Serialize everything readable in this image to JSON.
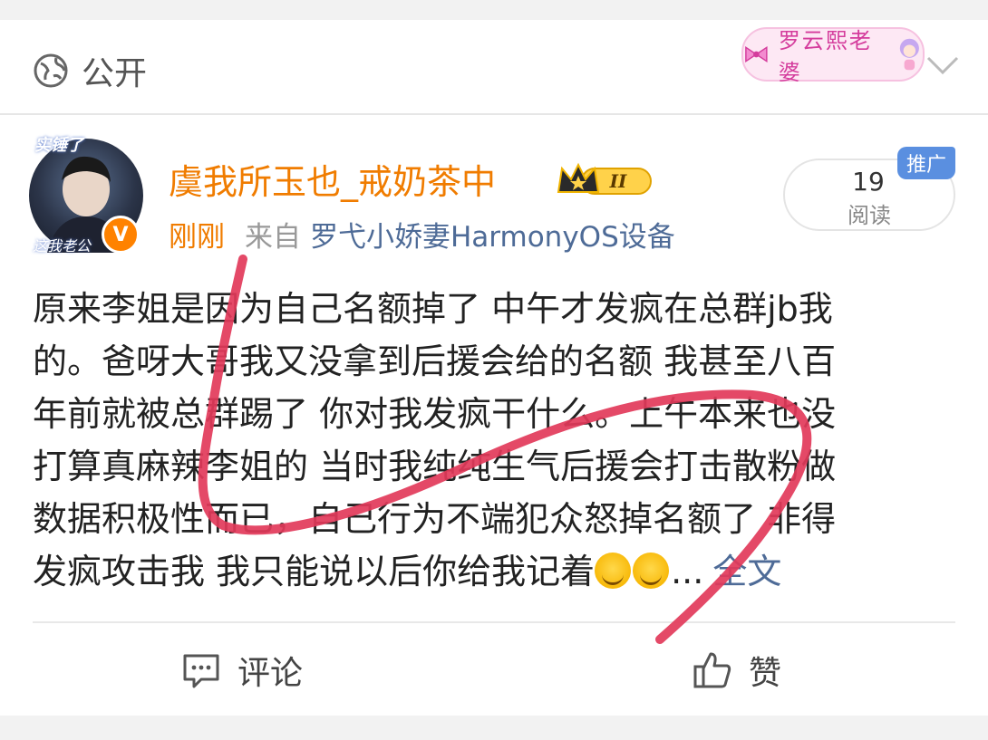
{
  "header": {
    "visibility_label": "公开",
    "sticker_text": "罗云熙老婆"
  },
  "post": {
    "author": {
      "username": "虞我所玉也_戒奶茶中",
      "avatar_tag_top": "实锤了",
      "avatar_tag_bottom": "这我老公",
      "verified_mark": "V",
      "membership_level": "II"
    },
    "time": "刚刚",
    "source_prefix": "来自",
    "source_device": "罗弋小娇妻HarmonyOS设备",
    "read_count": "19",
    "read_label": "阅读",
    "ad_badge": "推广",
    "body_lines": [
      "原来李姐是因为自己名额掉了 中午才发疯在总群jb我",
      "的。爸呀大哥我又没拿到后援会给的名额 我甚至八百",
      "年前就被总群踢了 你对我发疯干什么。上午本来也没",
      "打算真麻辣李姐的 当时我纯纯生气后援会打击散粉做",
      "数据积极性而已，自己行为不端犯众怒掉名额了 非得",
      "发疯攻击我 我只能说以后你给我记着"
    ],
    "ellipsis": "...",
    "full_text_link": "全文"
  },
  "actions": {
    "comment_label": "评论",
    "like_label": "赞"
  },
  "colors": {
    "username": "#f07c00",
    "link": "#4e6b97",
    "annotation_stroke": "#e23a5a"
  }
}
